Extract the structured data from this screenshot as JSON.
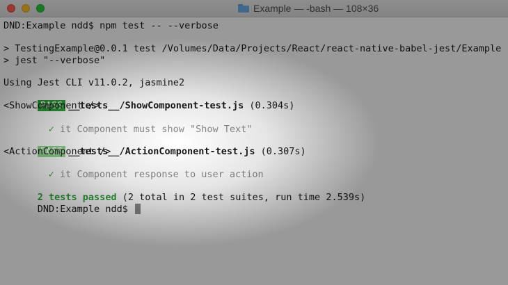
{
  "window": {
    "title": "Example — -bash — 108×36",
    "folder_icon": "folder-icon"
  },
  "terminal": {
    "prompt_command": "DND:Example ndd$ npm test -- --verbose",
    "script_line_1": "> TestingExample@0.0.1 test /Volumes/Data/Projects/React/react-native-babel-jest/Example",
    "script_line_2": "> jest \"--verbose\"",
    "jest_info": "Using Jest CLI v11.0.2, jasmine2",
    "suites": [
      {
        "status": "PASS",
        "file": "__tests__/ShowComponent-test.js",
        "time": "(0.304s)",
        "component": "<ShowComponent />",
        "check": "✓",
        "test": "it Component must show \"Show Text\""
      },
      {
        "status": "PASS",
        "file": "__tests__/ActionComponent-test.js",
        "time": "(0.307s)",
        "component": "<ActionComponent />",
        "check": "✓",
        "test": "it Component response to user action"
      }
    ],
    "summary_passed": "2 tests passed",
    "summary_rest": "(2 total in 2 test suites, run time 2.539s)",
    "final_prompt": "DND:Example ndd$"
  }
}
